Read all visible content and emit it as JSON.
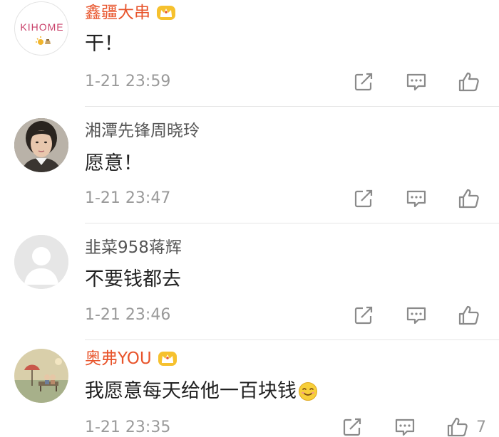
{
  "comments": [
    {
      "username": "鑫疆大串",
      "vip": true,
      "avatar": "kihome-logo-avatar",
      "avatar_logo_text": "KIHOME",
      "text": "干！",
      "time": "1-21 23:59",
      "like_count": ""
    },
    {
      "username": "湘潭先锋周晓玲",
      "vip": false,
      "avatar": "photo-avatar",
      "text": "愿意！",
      "time": "1-21 23:47",
      "like_count": ""
    },
    {
      "username": "韭菜958蒋辉",
      "vip": false,
      "avatar": "default-avatar",
      "text": "不要钱都去",
      "time": "1-21 23:46",
      "like_count": ""
    },
    {
      "username": "奥弗YOU",
      "vip": true,
      "avatar": "painting-avatar",
      "text": "我愿意每天给他一百块钱",
      "emoji": "smile-emoji",
      "time": "1-21 23:35",
      "like_count": "7"
    }
  ],
  "icons": {
    "share": "share-icon",
    "reply": "reply-icon",
    "like": "thumbs-up-icon",
    "vip": "crown-icon"
  },
  "colors": {
    "vip_name": "#e8542b",
    "normal_name": "#555555",
    "text": "#222222",
    "meta": "#9a9a9a",
    "divider": "#e6e6e6"
  }
}
